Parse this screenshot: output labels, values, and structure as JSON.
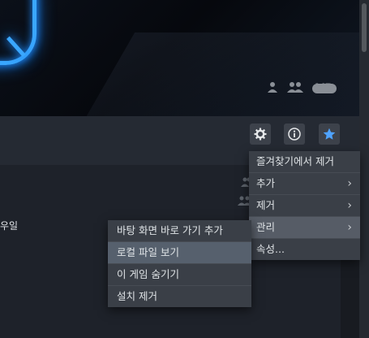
{
  "hero": {
    "icons": [
      "person-icon",
      "friends-icon"
    ],
    "vr_badge": "VR"
  },
  "toolbar": {
    "buttons": [
      "gear-icon",
      "info-icon",
      "star-icon"
    ],
    "accent": "#4fa3ff"
  },
  "content": {
    "left_text": "우일"
  },
  "context_menu": {
    "items": [
      {
        "label": "즐겨찾기에서 제거",
        "has_submenu": false
      },
      {
        "label": "추가",
        "has_submenu": true
      },
      {
        "label": "제거",
        "has_submenu": true
      },
      {
        "label": "관리",
        "has_submenu": true,
        "active": true
      },
      {
        "label": "속성...",
        "has_submenu": false
      }
    ]
  },
  "manage_submenu": {
    "items": [
      {
        "label": "바탕 화면 바로 가기 추가"
      },
      {
        "label": "로컬 파일 보기",
        "highlighted": true
      },
      {
        "label": "이 게임 숨기기"
      },
      {
        "label": "설치 제거"
      }
    ]
  }
}
